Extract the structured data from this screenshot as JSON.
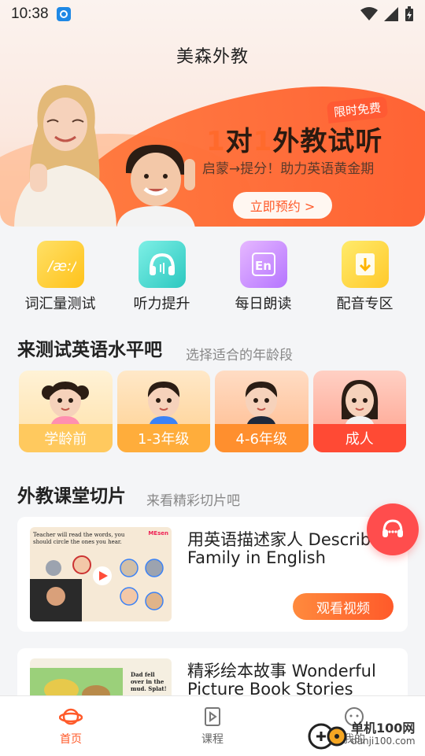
{
  "status_bar": {
    "time": "10:38"
  },
  "header": {
    "app_title": "美森外教"
  },
  "banner": {
    "badge": "限时免费",
    "headline_num1": "1",
    "headline_mid": "对",
    "headline_num2": "1",
    "headline_rest": "外教试听",
    "subtitle": "启蒙→提分！助力英语黄金期",
    "cta_label": "立即预约 >"
  },
  "shortcuts": [
    {
      "label": "词汇量测试",
      "icon": "vocabulary-icon",
      "color": "#ffcf2e"
    },
    {
      "label": "听力提升",
      "icon": "headphones-icon",
      "color": "#3fd7d0"
    },
    {
      "label": "每日朗读",
      "icon": "en-reading-icon",
      "color": "#c98cff"
    },
    {
      "label": "配音专区",
      "icon": "dubbing-icon",
      "color": "#ffd83a"
    }
  ],
  "level_section": {
    "title": "来测试英语水平吧",
    "subtitle": "选择适合的年龄段",
    "levels": [
      {
        "label": "学龄前",
        "color": "#ffd27a"
      },
      {
        "label": "1-3年级",
        "color": "#ffb347"
      },
      {
        "label": "4-6年级",
        "color": "#ff9a3d"
      },
      {
        "label": "成人",
        "color": "#ff4d3a"
      }
    ]
  },
  "clips_section": {
    "title": "外教课堂切片",
    "subtitle": "来看精彩切片吧",
    "cards": [
      {
        "title": "用英语描述家人 Describe Family in English",
        "button": "观看视频",
        "thumb_caption_1": "Teacher will read the words, you should circle the ones you hear.",
        "thumb_brand": "MEsen"
      },
      {
        "title": "精彩绘本故事 Wonderful Picture Book Stories",
        "thumb_caption_1": "Dad fell over in the mud. Splat!"
      }
    ]
  },
  "tab_bar": {
    "tabs": [
      {
        "label": "首页",
        "icon": "planet-icon",
        "active": true
      },
      {
        "label": "课程",
        "icon": "course-play-icon",
        "active": false
      },
      {
        "label": "我的",
        "icon": "profile-icon",
        "active": false
      }
    ]
  },
  "watermark": {
    "main": "单机100网",
    "url": "danji100.com"
  },
  "colors": {
    "accent": "#ff5a2a",
    "fab": "#ff4d4d"
  }
}
